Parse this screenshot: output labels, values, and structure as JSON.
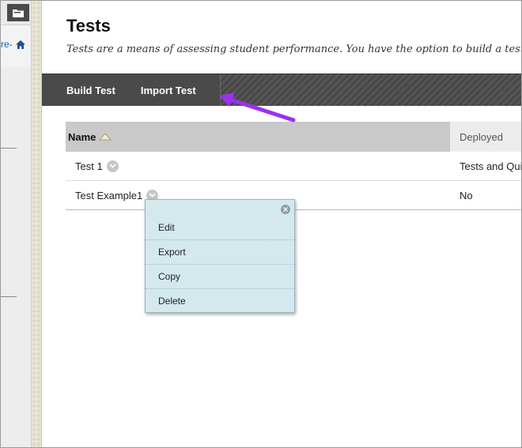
{
  "sidebar": {
    "course_fragment": "re-",
    "icons": [
      "folder-icon",
      "home-icon"
    ]
  },
  "page": {
    "title": "Tests",
    "description": "Tests are a means of assessing student performance. You have the option to build a test or i"
  },
  "toolbar": {
    "build_label": "Build Test",
    "import_label": "Import Test"
  },
  "annotation": {
    "arrow_color": "#9b30f0"
  },
  "table": {
    "headers": {
      "name": "Name",
      "deployed": "Deployed"
    },
    "sort": "ascending",
    "rows": [
      {
        "name": "Test 1",
        "deployed": "Tests and Qui"
      },
      {
        "name": "Test Example1",
        "deployed": "No"
      }
    ]
  },
  "context_menu": {
    "items": [
      "Edit",
      "Export",
      "Copy",
      "Delete"
    ]
  },
  "colors": {
    "toolbar": "#4b4b4b",
    "menu_bg": "#d3e9ee",
    "header_bg": "#c9c9c9",
    "link": "#1f5ea8"
  }
}
